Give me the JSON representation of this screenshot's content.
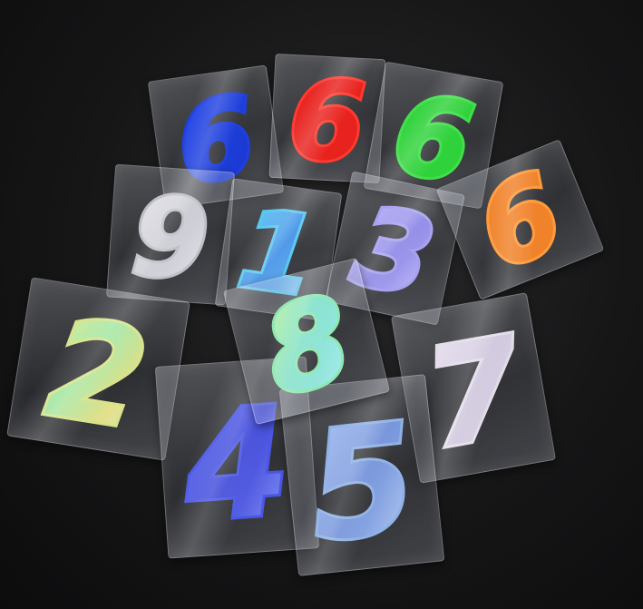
{
  "stickers": [
    {
      "digit": "6",
      "color": "#1f3fe0",
      "fill_style": "solid"
    },
    {
      "digit": "6",
      "color": "#e8231f",
      "fill_style": "solid"
    },
    {
      "digit": "6",
      "color": "#2fd23a",
      "fill_style": "solid"
    },
    {
      "digit": "9",
      "color": "#e6e6ea",
      "fill_style": "holographic"
    },
    {
      "digit": "1",
      "color": "#58c8f0",
      "fill_style": "holographic"
    },
    {
      "digit": "3",
      "color": "#a7a2ef",
      "fill_style": "holographic"
    },
    {
      "digit": "6",
      "color": "#f0822a",
      "fill_style": "solid"
    },
    {
      "digit": "2",
      "color": "#d9e38a",
      "fill_style": "holographic"
    },
    {
      "digit": "8",
      "color": "#8fe8b0",
      "fill_style": "holographic"
    },
    {
      "digit": "7",
      "color": "#e3dde8",
      "fill_style": "holographic"
    },
    {
      "digit": "4",
      "color": "#4a57e6",
      "fill_style": "holographic"
    },
    {
      "digit": "5",
      "color": "#8fb1e6",
      "fill_style": "holographic"
    }
  ]
}
